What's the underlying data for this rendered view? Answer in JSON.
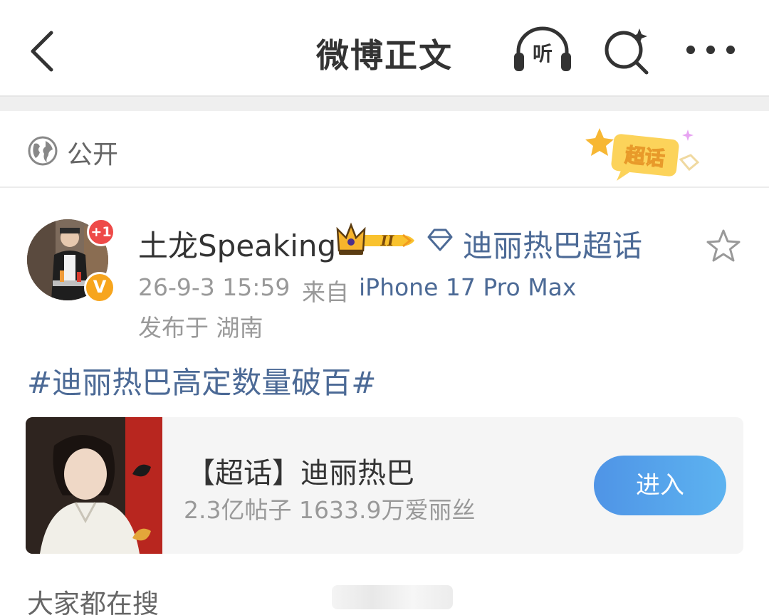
{
  "header": {
    "title": "微博正文",
    "listen_label": "听"
  },
  "visibility": {
    "label": "公开"
  },
  "supertopic_badge": {
    "label": "超话"
  },
  "post": {
    "author": {
      "name": "土龙Speaking",
      "plus_badge": "+1",
      "verified_badge": "V",
      "level_badge": "II"
    },
    "topic_source": "迪丽热巴超话",
    "time": "26-9-3 15:59",
    "from_label": "来自",
    "device": "iPhone 17 Pro Max",
    "location": "发布于 湖南",
    "hashtag": "#迪丽热巴高定数量破百#",
    "card": {
      "title": "【超话】迪丽热巴",
      "stats": "2.3亿帖子 1633.9万爱丽丝",
      "button_label": "进入"
    }
  },
  "search_section": {
    "heading": "大家都在搜"
  },
  "icons": {
    "back": "chevron-left-icon",
    "listen": "headphones-icon",
    "search": "search-sparkle-icon",
    "more": "more-dots-icon",
    "globe": "globe-icon",
    "gem": "diamond-icon",
    "star": "star-outline-icon",
    "crown": "crown-icon"
  },
  "colors": {
    "link": "#4c6a96",
    "text_primary": "#333333",
    "text_secondary": "#999999",
    "enter_button": "#4f94e6",
    "plus_badge": "#ee4a48",
    "verified_badge": "#f7a51d",
    "page_background": "#ffffff",
    "separator": "#efefef"
  }
}
